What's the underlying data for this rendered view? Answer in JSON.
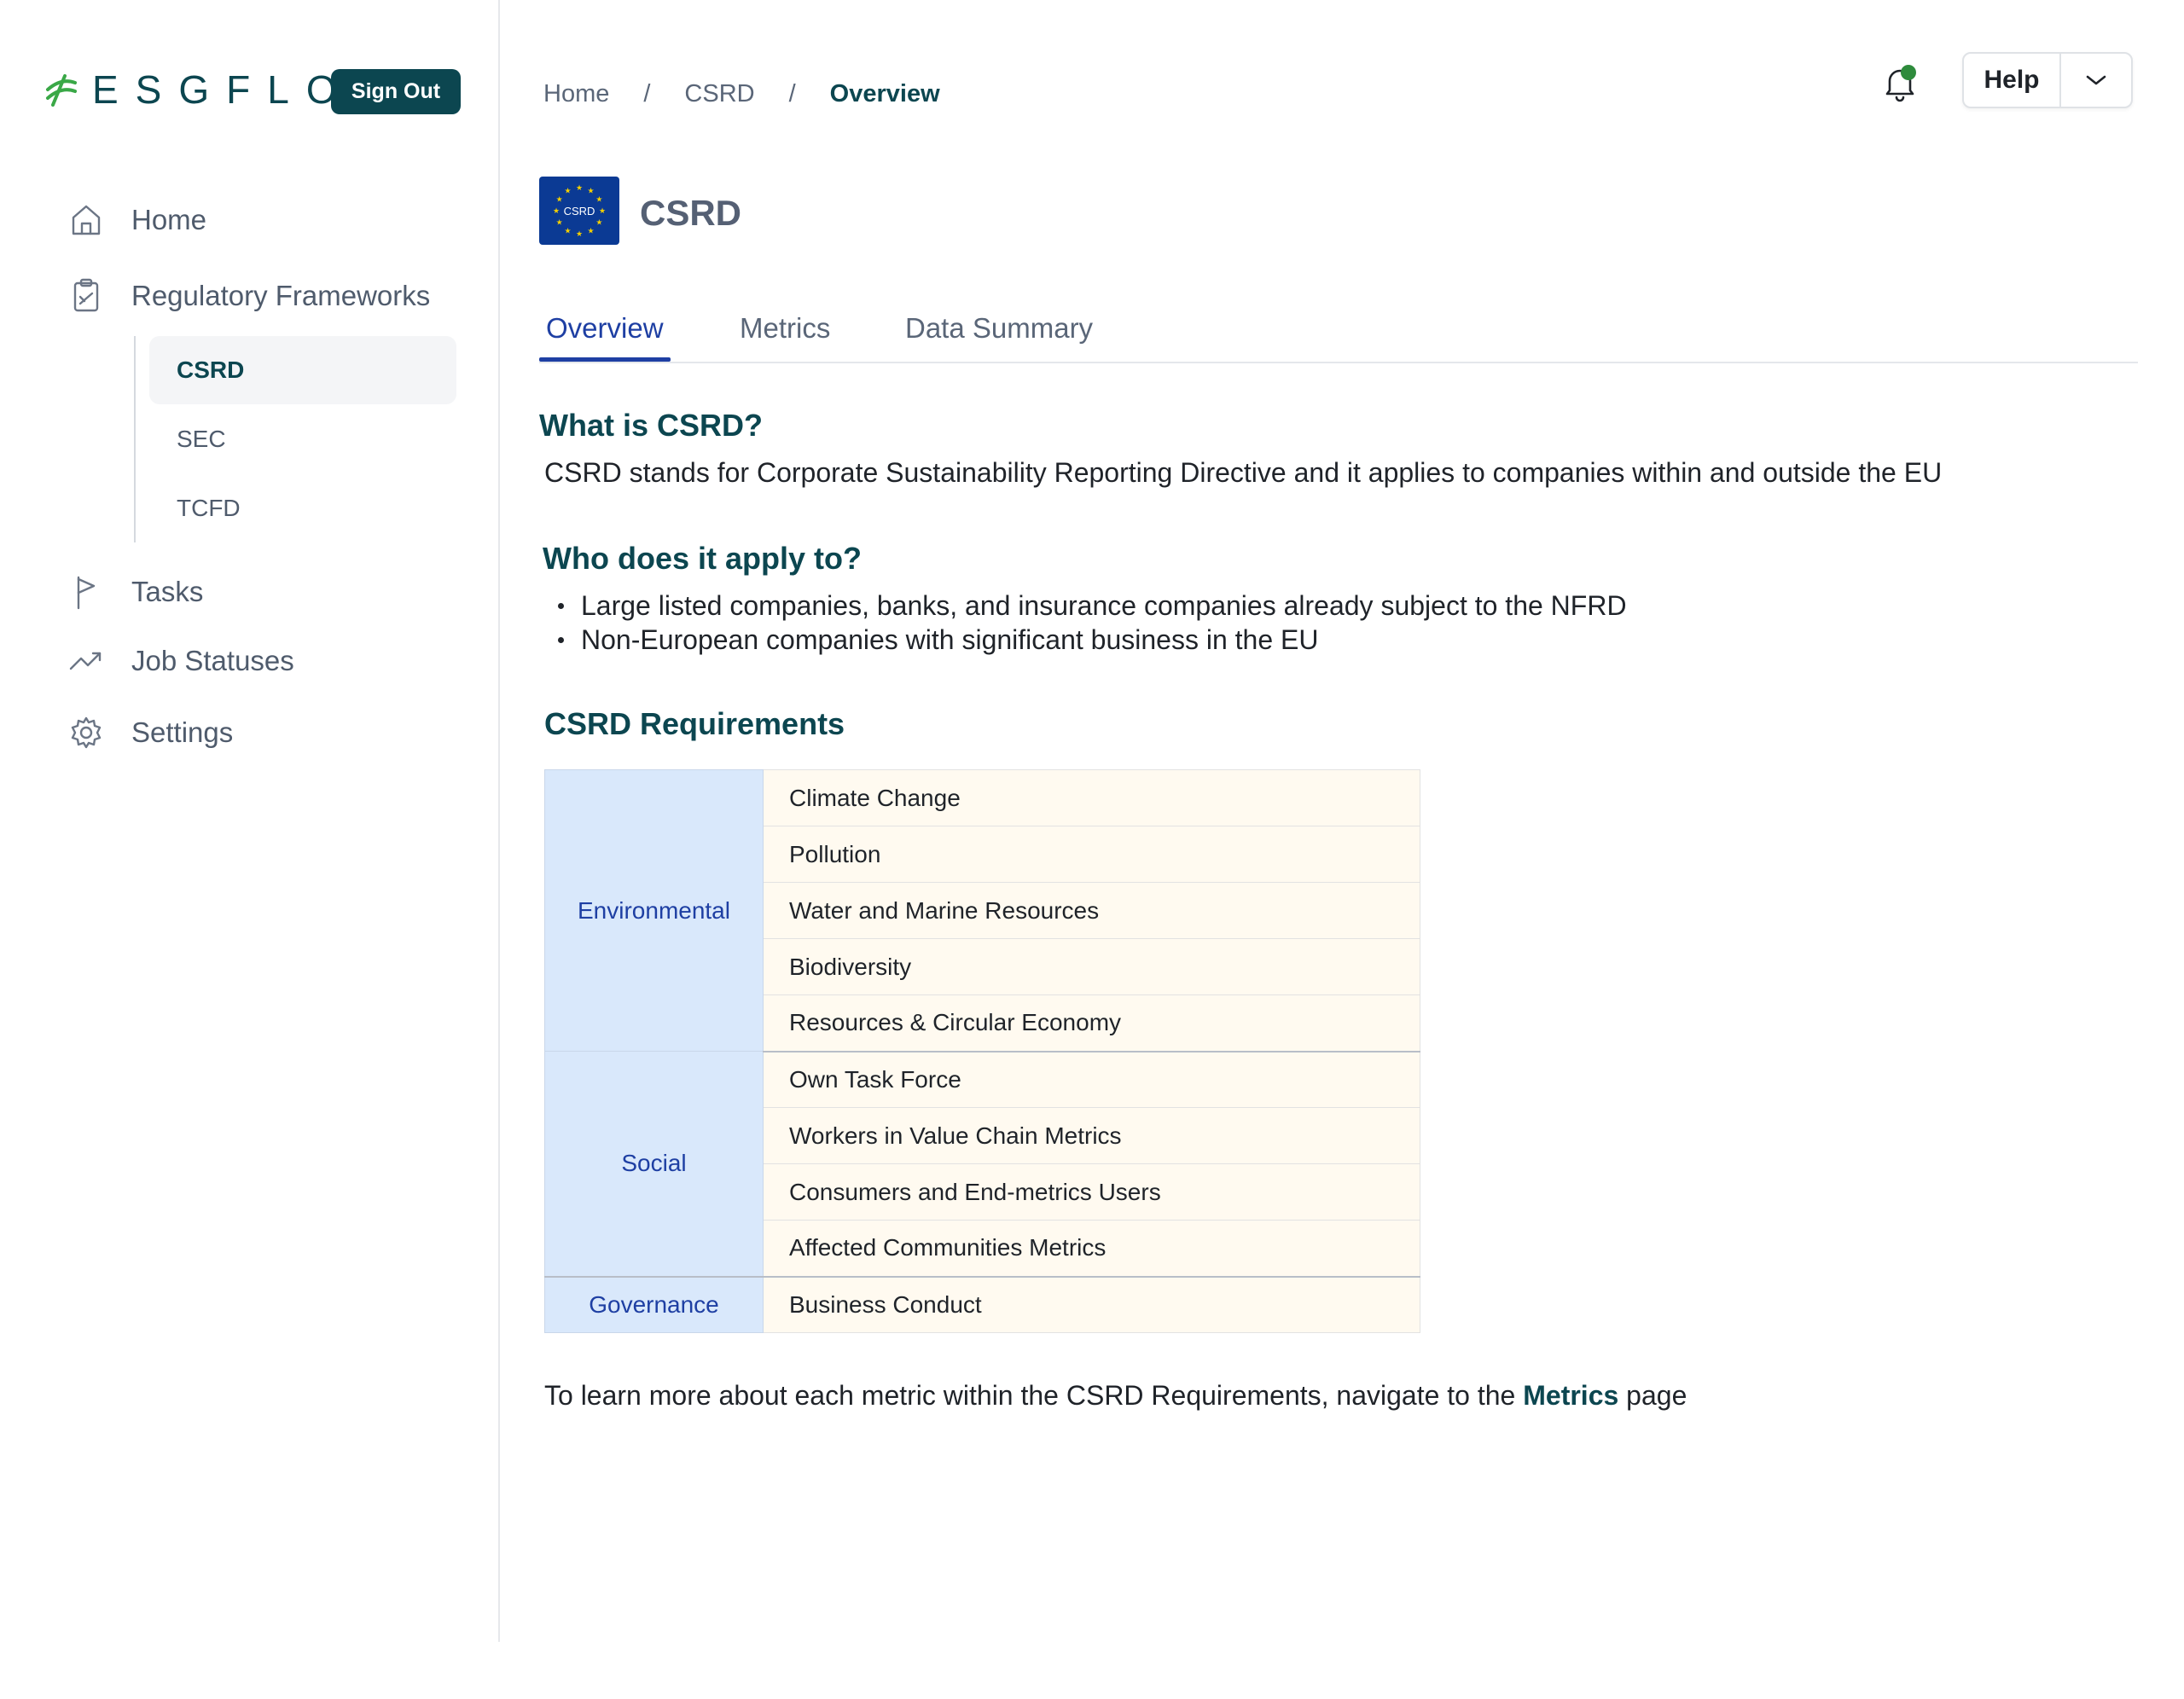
{
  "brand": {
    "name": "ESGFLO",
    "sign_out_label": "Sign Out"
  },
  "sidebar": {
    "items": [
      {
        "label": "Home",
        "icon": "home-icon"
      },
      {
        "label": "Regulatory Frameworks",
        "icon": "clipboard-icon"
      },
      {
        "label": "Tasks",
        "icon": "flag-icon"
      },
      {
        "label": "Job Statuses",
        "icon": "trending-up-icon"
      },
      {
        "label": "Settings",
        "icon": "gear-icon"
      }
    ],
    "subitems": [
      {
        "label": "CSRD",
        "active": true
      },
      {
        "label": "SEC",
        "active": false
      },
      {
        "label": "TCFD",
        "active": false
      }
    ]
  },
  "breadcrumb": {
    "items": [
      "Home",
      "CSRD"
    ],
    "current": "Overview",
    "separator": "/"
  },
  "header": {
    "help_label": "Help",
    "notification_dot_color": "#2e8b3c"
  },
  "page": {
    "badge_text": "CSRD",
    "title": "CSRD"
  },
  "tabs": [
    {
      "label": "Overview",
      "active": true
    },
    {
      "label": "Metrics",
      "active": false
    },
    {
      "label": "Data Summary",
      "active": false
    }
  ],
  "content": {
    "what_heading": "What is CSRD?",
    "what_text": "CSRD stands for Corporate Sustainability Reporting Directive and it applies to companies within and outside the EU",
    "who_heading": "Who does it apply to?",
    "who_bullets": [
      "Large listed companies, banks, and insurance companies already subject to the NFRD",
      "Non-European companies with significant business in the EU"
    ],
    "requirements_heading": "CSRD Requirements",
    "requirements": {
      "environmental": {
        "label": "Environmental",
        "items": [
          "Climate Change",
          "Pollution",
          "Water and Marine Resources",
          "Biodiversity",
          "Resources & Circular Economy"
        ]
      },
      "social": {
        "label": "Social",
        "items": [
          "Own Task Force",
          "Workers in Value Chain Metrics",
          "Consumers and End-metrics Users",
          "Affected Communities Metrics"
        ]
      },
      "governance": {
        "label": "Governance",
        "items": [
          "Business Conduct"
        ]
      }
    },
    "footer_prefix": "To learn more about each metric within the CSRD Requirements, navigate to the ",
    "footer_link": "Metrics",
    "footer_suffix": " page"
  },
  "colors": {
    "brand_dark": "#0c4650",
    "brand_green": "#3aa847",
    "accent_blue": "#1e3fa3",
    "category_bg": "#d9e8fb",
    "item_bg": "#fffaf0",
    "eu_blue": "#0b3a94",
    "eu_star": "#f5d000"
  }
}
